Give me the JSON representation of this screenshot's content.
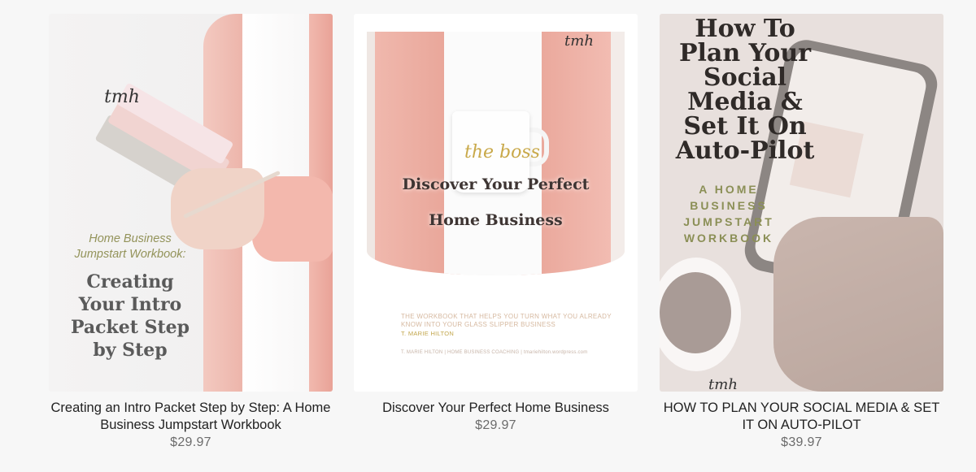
{
  "products": [
    {
      "title": "Creating an Intro Packet Step by Step: A Home Business Jumpstart Workbook",
      "price": "$29.97",
      "cover": {
        "logo": "tmh",
        "subtitle_line1": "Home Business",
        "subtitle_line2": "Jumpstart Workbook:",
        "title_lines": [
          "Creating",
          "Your Intro",
          "Packet Step",
          "by Step"
        ]
      }
    },
    {
      "title": "Discover Your Perfect Home Business",
      "price": "$29.97",
      "cover": {
        "logo": "tmh",
        "mug_text": "the boss",
        "headline_line1": "Discover Your Perfect",
        "headline_line2": "Home Business",
        "tagline": "THE WORKBOOK THAT HELPS YOU TURN WHAT YOU ALREADY KNOW INTO YOUR GLASS SLIPPER BUSINESS",
        "author": "T. MARIE HILTON",
        "footer": "T. MARIE HILTON | HOME BUSINESS COACHING | tmariehilton.wordpress.com"
      }
    },
    {
      "title": "HOW TO PLAN YOUR SOCIAL MEDIA & SET IT ON AUTO-PILOT",
      "price": "$39.97",
      "cover": {
        "logo": "tmh",
        "title_lines": [
          "How To",
          "Plan Your",
          "Social",
          "Media &",
          "Set It On",
          "Auto-Pilot"
        ],
        "subtitle_lines": [
          "A HOME",
          "BUSINESS",
          "JUMPSTART",
          "WORKBOOK"
        ]
      }
    }
  ]
}
